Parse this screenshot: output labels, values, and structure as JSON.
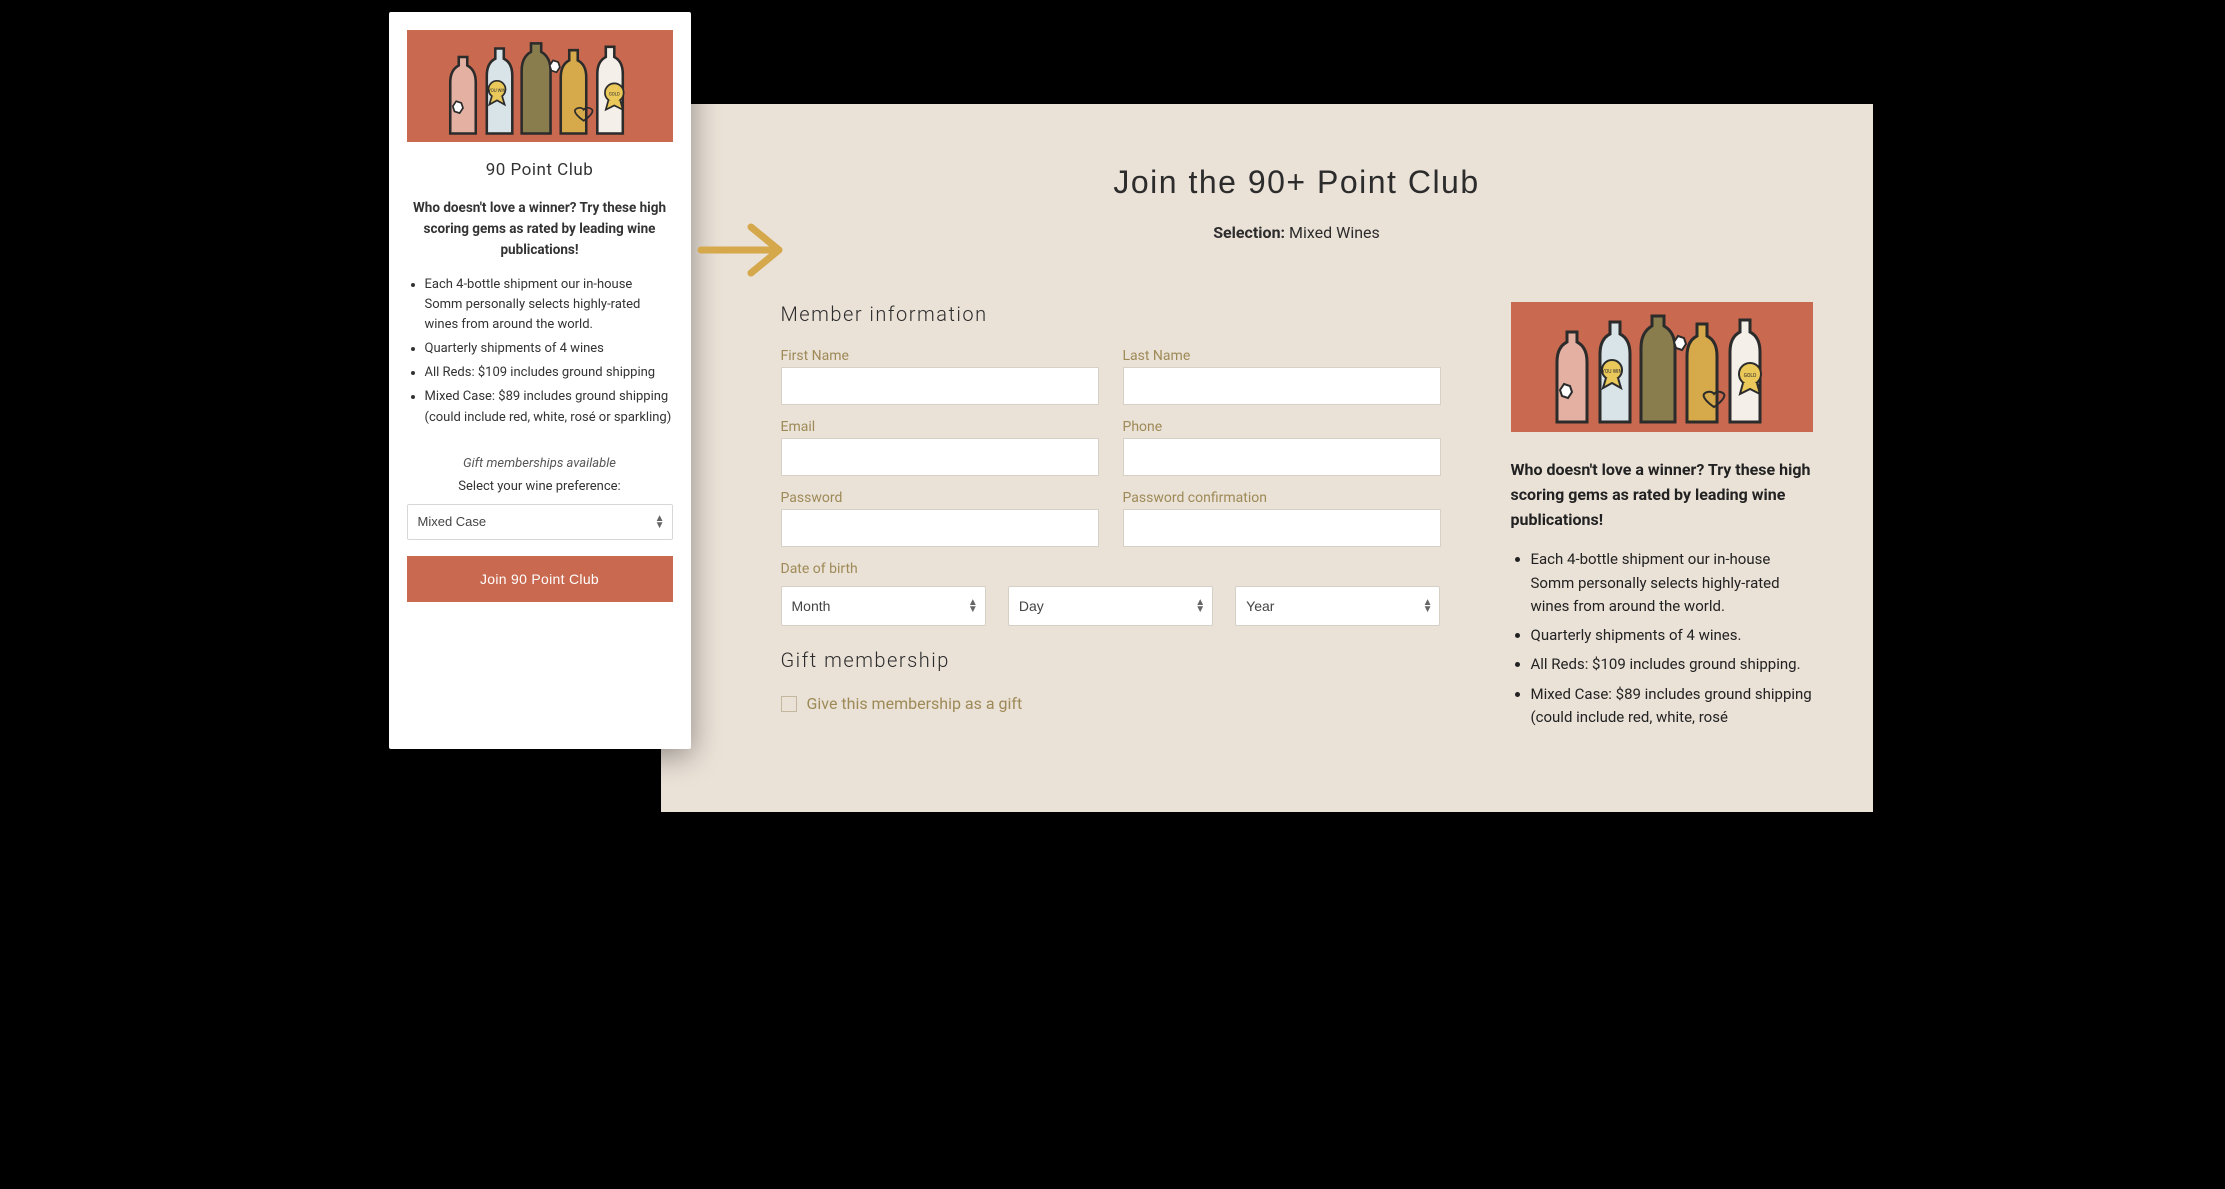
{
  "card": {
    "title": "90 Point Club",
    "lead": "Who doesn't love a winner?  Try these high scoring gems as rated by leading wine publications!",
    "bullets": [
      "Each 4-bottle shipment our in-house Somm personally selects highly-rated wines from around the world.",
      "Quarterly shipments of 4 wines",
      "All Reds: $109 includes ground shipping",
      "Mixed Case: $89 includes ground shipping (could include red, white, rosé or sparkling)"
    ],
    "gift_note": "Gift memberships available",
    "preference_label": "Select your wine preference:",
    "preference_value": "Mixed Case",
    "join_label": "Join 90 Point Club"
  },
  "page": {
    "title": "Join the 90+ Point Club",
    "selection_label": "Selection:",
    "selection_value": "Mixed Wines"
  },
  "form": {
    "section_member": "Member information",
    "first_name_label": "First Name",
    "last_name_label": "Last Name",
    "email_label": "Email",
    "phone_label": "Phone",
    "password_label": "Password",
    "password_confirm_label": "Password confirmation",
    "dob_label": "Date of birth",
    "month_placeholder": "Month",
    "day_placeholder": "Day",
    "year_placeholder": "Year",
    "section_gift": "Gift membership",
    "gift_checkbox_label": "Give this membership as a gift"
  },
  "sidebar": {
    "lead": "Who doesn't love a winner?  Try these high scoring gems as rated by leading wine publications!",
    "bullets": [
      "Each 4-bottle shipment our in-house Somm personally selects highly-rated wines from around the world.",
      "Quarterly shipments of 4 wines.",
      "All Reds: $109 includes ground shipping.",
      "Mixed Case: $89 includes ground shipping (could include red, white, rosé"
    ]
  }
}
